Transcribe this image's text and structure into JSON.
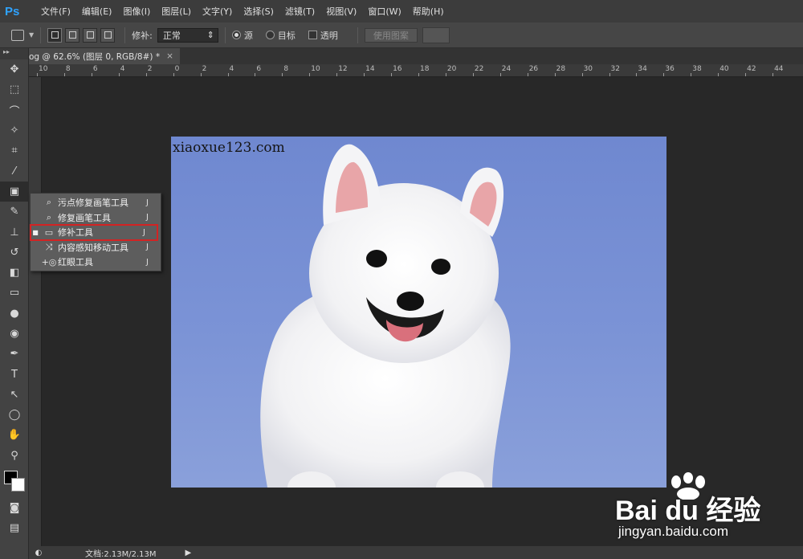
{
  "app": {
    "logo": "Ps"
  },
  "menu": [
    "文件(F)",
    "编辑(E)",
    "图像(I)",
    "图层(L)",
    "文字(Y)",
    "选择(S)",
    "滤镜(T)",
    "视图(V)",
    "窗口(W)",
    "帮助(H)"
  ],
  "options": {
    "patch_label": "修补:",
    "patch_value": "正常",
    "source_label": "源",
    "target_label": "目标",
    "transparent_label": "透明",
    "use_pattern_label": "使用图案"
  },
  "document": {
    "tab_title": "og @ 62.6% (图层 0, RGB/8#) *",
    "close": "×",
    "image_watermark": "xiaoxue123.com"
  },
  "ruler": {
    "top_labels": [
      "10",
      "8",
      "6",
      "4",
      "2",
      "0",
      "2",
      "4",
      "6",
      "8",
      "10",
      "12",
      "14",
      "16",
      "18",
      "20",
      "22",
      "24",
      "26",
      "28",
      "30",
      "32",
      "34",
      "36",
      "38",
      "40",
      "42",
      "44"
    ]
  },
  "flyout": {
    "items": [
      {
        "label": "污点修复画笔工具",
        "key": "J",
        "icon": "spot-healing-brush-icon",
        "selected": false
      },
      {
        "label": "修复画笔工具",
        "key": "J",
        "icon": "healing-brush-icon",
        "selected": false
      },
      {
        "label": "修补工具",
        "key": "J",
        "icon": "patch-icon",
        "selected": true
      },
      {
        "label": "内容感知移动工具",
        "key": "J",
        "icon": "content-aware-move-icon",
        "selected": false
      },
      {
        "label": "红眼工具",
        "key": "J",
        "icon": "red-eye-icon",
        "selected": false
      }
    ]
  },
  "status": {
    "doc_size": "文档:2.13M/2.13M",
    "arrow": "▶"
  },
  "watermark": {
    "brand": "Bai du 经验",
    "url": "jingyan.baidu.com"
  },
  "colors": {
    "highlight": "#d32323",
    "image_sky": "#7b93d6",
    "ps_blue": "#2fa3ff"
  }
}
